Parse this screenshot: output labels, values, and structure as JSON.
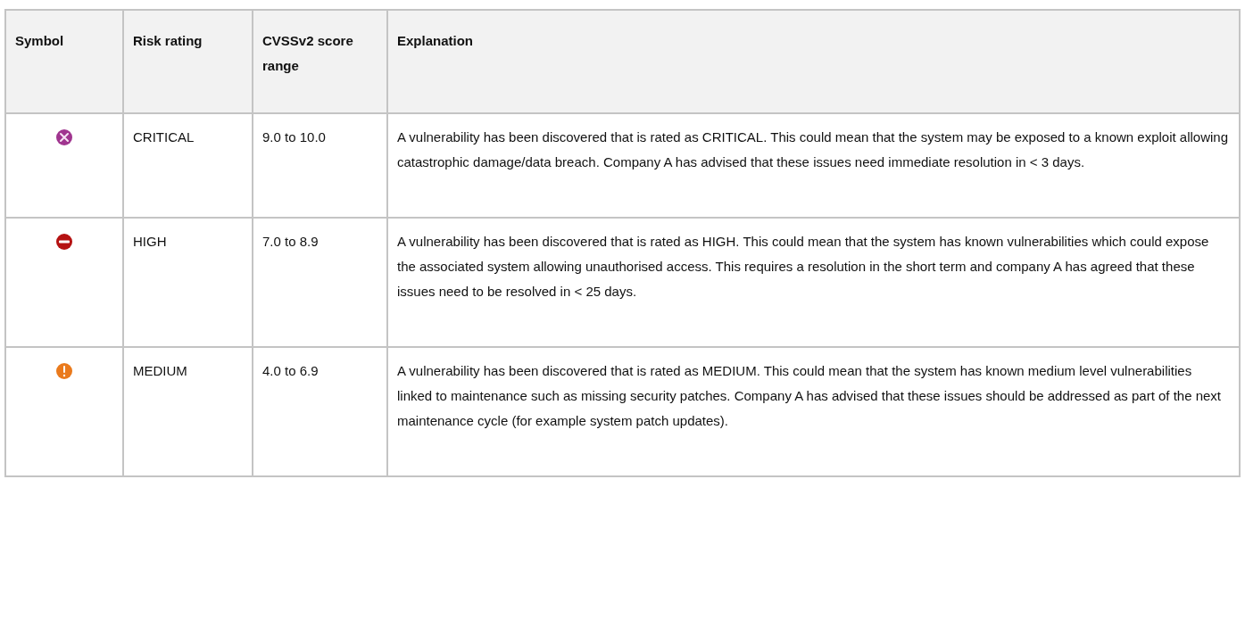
{
  "table": {
    "columns": [
      "Symbol",
      "Risk rating",
      "CVSSv2 score range",
      "Explanation"
    ],
    "rows": [
      {
        "symbol": {
          "kind": "critical"
        },
        "risk_rating": "CRITICAL",
        "score_range": "9.0 to 10.0",
        "explanation": "A vulnerability has been discovered that is rated as CRITICAL. This could mean that the system may be exposed to a known exploit allowing catastrophic damage/data breach. Company A has advised that these issues need immediate resolution in < 3 days."
      },
      {
        "symbol": {
          "kind": "high"
        },
        "risk_rating": "HIGH",
        "score_range": "7.0 to 8.9",
        "explanation": "A vulnerability has been discovered that is rated as HIGH. This could mean that the system has known vulnerabilities which could expose the associated system allowing unauthorised access. This requires a resolution in the short term and company A has agreed that these issues need to be resolved in < 25 days."
      },
      {
        "symbol": {
          "kind": "medium"
        },
        "risk_rating": "MEDIUM",
        "score_range": "4.0 to 6.9",
        "explanation": "A vulnerability has been discovered that is rated as MEDIUM. This could mean that the system has known medium level vulnerabilities linked to maintenance such as missing security patches. Company A has advised that these issues should be addressed as part of the next maintenance cycle (for example system patch updates)."
      }
    ]
  }
}
